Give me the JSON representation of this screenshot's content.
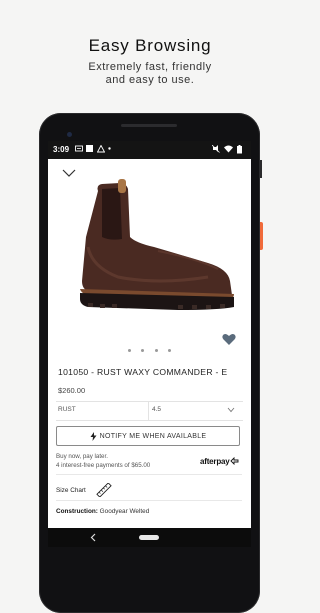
{
  "promo": {
    "title": "Easy Browsing",
    "subtitle_line1": "Extremely fast, friendly",
    "subtitle_line2": "and easy to use."
  },
  "status_bar": {
    "time": "3:09"
  },
  "product": {
    "title": "101050 - RUST WAXY COMMANDER - E",
    "price": "$260.00",
    "image_icon": "chelsea-boot",
    "carousel_dots": 4
  },
  "selectors": {
    "color": "RUST",
    "size": "4.5"
  },
  "notify_button": {
    "label": "NOTIFY ME WHEN AVAILABLE"
  },
  "afterpay": {
    "line1": "Buy now, pay later.",
    "line2": "4 interest-free payments of $65.00",
    "logo": "afterpay"
  },
  "size_chart": {
    "label": "Size Chart"
  },
  "construction": {
    "label": "Construction:",
    "value": "Goodyear Welted"
  },
  "colors": {
    "accent_side_button": "#f06a3a",
    "favorite_icon": "#5a6b7c",
    "boot_leather": "#4a2a22"
  }
}
